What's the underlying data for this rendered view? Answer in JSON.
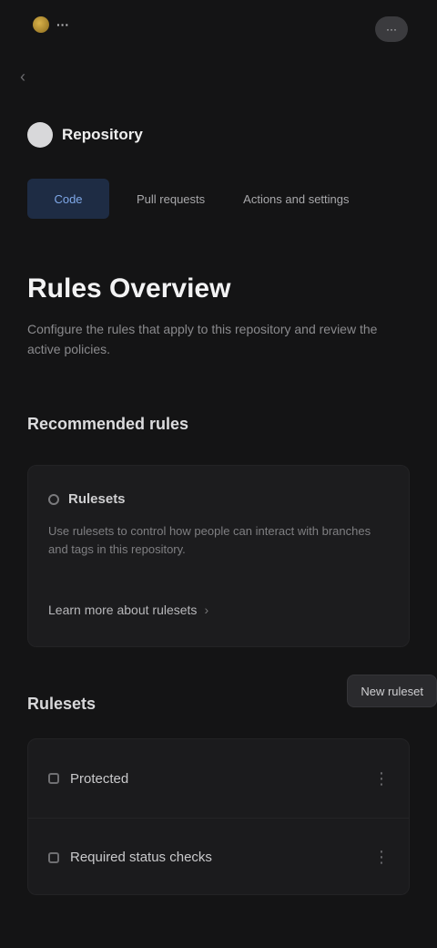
{
  "topbar": {
    "brand_text": "···",
    "action_label": "···"
  },
  "repo": {
    "name": "Repository"
  },
  "tabs": [
    {
      "label": "Code"
    },
    {
      "label": "Pull requests"
    },
    {
      "label": "Actions and settings"
    }
  ],
  "page": {
    "title": "Rules Overview",
    "subtitle": "Configure the rules that apply to this repository and review the active policies."
  },
  "recommended": {
    "title": "Recommended rules",
    "card_title": "Rulesets",
    "card_desc": "Use rulesets to control how people can interact with branches and tags in this repository.",
    "card_link": "Learn more about rulesets"
  },
  "rules_list": {
    "title": "Rulesets",
    "new_button": "New ruleset",
    "items": [
      {
        "label": "Protected"
      },
      {
        "label": "Required status checks"
      }
    ]
  },
  "icons": {
    "brand": "logo-icon",
    "back": "arrow-left-icon",
    "kebab": "kebab-menu-icon"
  }
}
